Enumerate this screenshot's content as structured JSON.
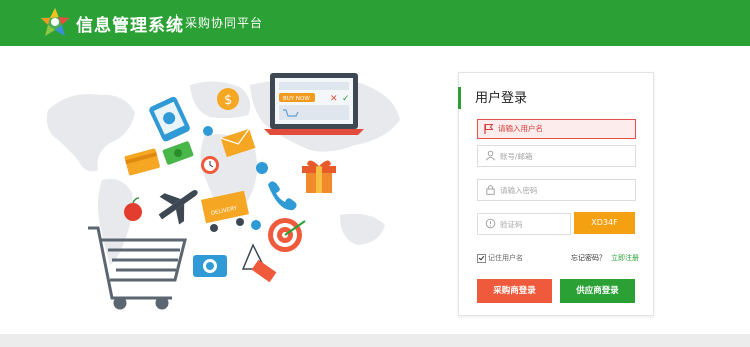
{
  "header": {
    "system_title": "信息管理系统",
    "platform_name": "采购协同平台"
  },
  "hero": {
    "illustration_icons": [
      "world-map",
      "laptop-icon",
      "shopping-cart-icon",
      "airplane-icon",
      "delivery-truck-icon",
      "gift-icon",
      "target-icon",
      "camera-icon",
      "phone-icon",
      "coin-icon",
      "envelope-icon",
      "alarm-clock-icon",
      "apple-icon",
      "credit-card-icon",
      "price-tag-icon",
      "mobile-phone-icon",
      "gear-icon"
    ],
    "laptop_button": "BUY NOW",
    "truck_label": "DELIVERY"
  },
  "login": {
    "title": "用户登录",
    "error_message": "请输入用户名",
    "username_placeholder": "账号/邮箱",
    "password_placeholder": "请输入密码",
    "captcha_placeholder": "验证码",
    "captcha_code": "XD34F",
    "remember_label": "记住用户名",
    "forgot_link": "忘记密码？",
    "register_link": "立即注册",
    "buyer_login_label": "采购商登录",
    "supplier_login_label": "供应商登录"
  },
  "colors": {
    "brand_green": "#2aa035",
    "error_red": "#e3504d",
    "captcha_orange": "#f5a011",
    "buyer_button": "#ef5a3c",
    "supplier_button": "#2aa035"
  }
}
